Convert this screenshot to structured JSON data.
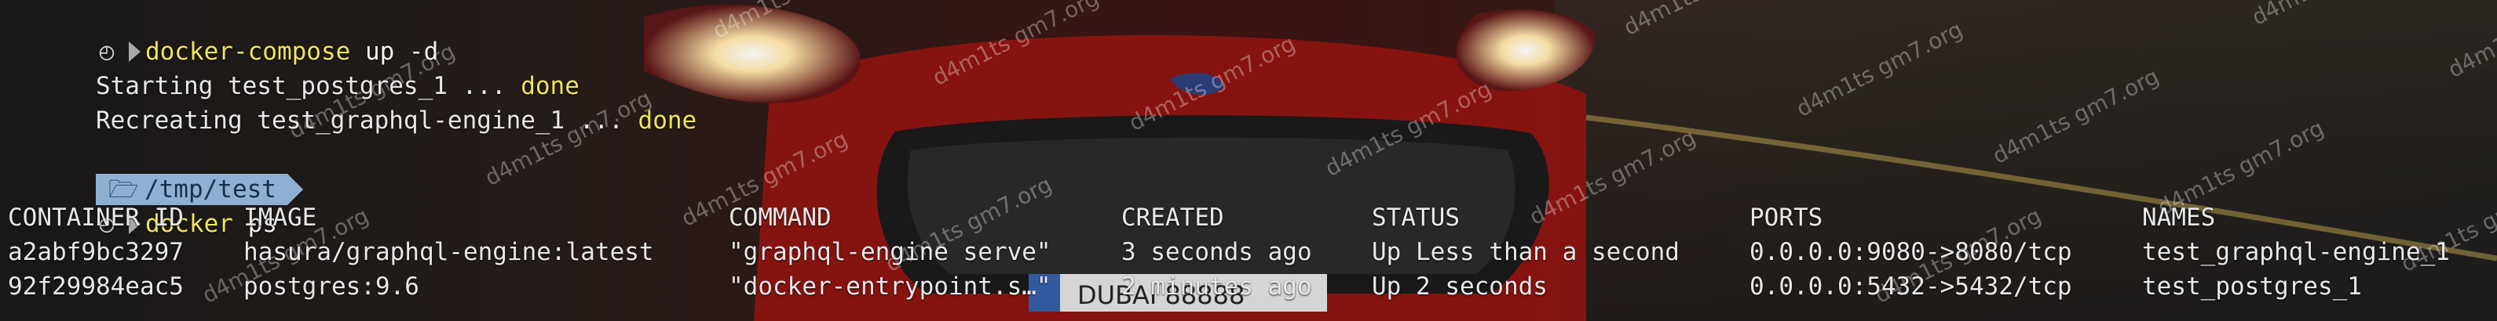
{
  "terminal": {
    "line1": {
      "command": "docker-compose",
      "args": " up -d"
    },
    "line2": {
      "text": "Starting test_postgres_1 ... ",
      "status": "done"
    },
    "line3": {
      "text": "Recreating test_graphql-engine_1 ... ",
      "status": "done"
    },
    "prompt_path": "/tmp/test",
    "line5": {
      "command": "docker",
      "args": " ps"
    },
    "table": {
      "headers": [
        "CONTAINER ID",
        "IMAGE",
        "COMMAND",
        "CREATED",
        "STATUS",
        "PORTS",
        "NAMES"
      ],
      "rows": [
        [
          "a2abf9bc3297",
          "hasura/graphql-engine:latest",
          "\"graphql-engine serve\"",
          "3 seconds ago",
          "Up Less than a second",
          "0.0.0.0:9080->8080/tcp",
          "test_graphql-engine_1"
        ],
        [
          "92f29984eac5",
          "postgres:9.6",
          "\"docker-entrypoint.s…\"",
          "2 minutes ago",
          "Up 2 seconds",
          "0.0.0.0:5432->5432/tcp",
          "test_postgres_1"
        ]
      ]
    }
  },
  "icons": {
    "prompt": "prompt-symbol-icon",
    "arrow": "prompt-arrow-icon",
    "folder": "folder-icon"
  },
  "watermark": {
    "text": "d4m1ts gm7.org"
  },
  "colors": {
    "command": "#f0e55a",
    "path_chip": "#8fb0d2"
  }
}
